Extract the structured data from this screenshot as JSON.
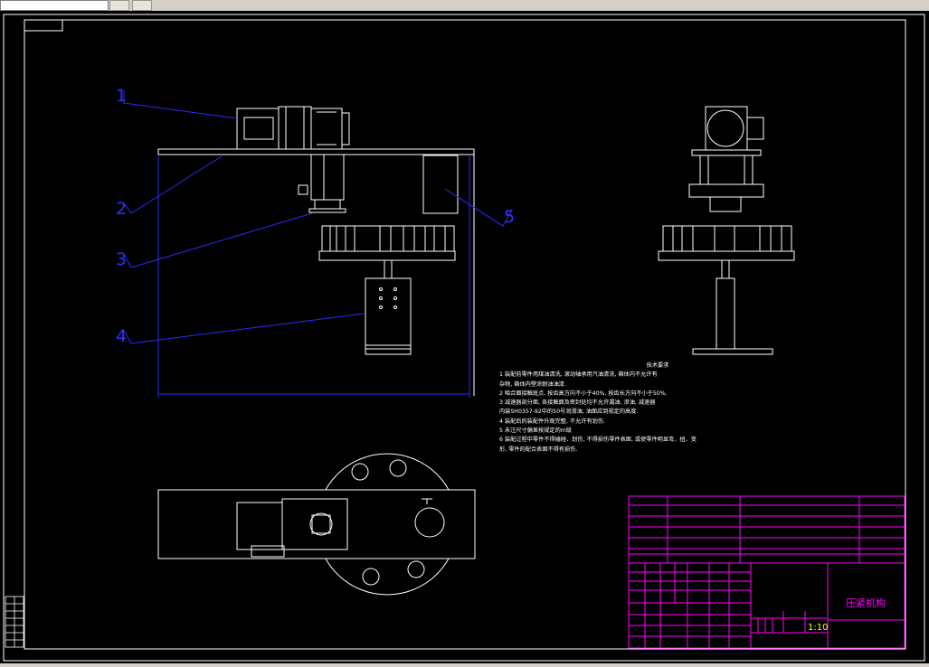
{
  "drawing_title": "压紧机构",
  "scale": "1:10",
  "part_labels": [
    "1",
    "2",
    "3",
    "4",
    "5"
  ],
  "tech_requirements": {
    "heading": "技术要求",
    "lines": [
      "1 装配前零件用煤油清洗, 滚动轴承用汽油清洗, 箱体内不允许有",
      "   杂物, 箱体内壁涂耐油油漆.",
      "2 啮合面接触斑点, 按齿高方向不小于40%, 按齿长方向不小于50%.",
      "3 减速器剖分面, 各接触面及密封处均不允许漏油, 渗油, 减速器",
      "   内装SH0357-92中的50号润滑油, 油面应到规定的高度.",
      "4 装配后的装配件外观完整, 不允许有划伤.",
      "5 未注尺寸偏差按规定的m级",
      "6 装配过程中零件不得磕碰、划伤, 不得损伤零件表面, 或使零件明显弯、扭、变",
      "形, 零件的配合表面不得有损伤."
    ]
  },
  "colors": {
    "background": "#000000",
    "geometry": "#ffffff",
    "leaders": "#2b2bff",
    "titleblock_lines": "#ff00ff",
    "table_text": "#ff00ff",
    "accent_text": "#ffff00"
  }
}
